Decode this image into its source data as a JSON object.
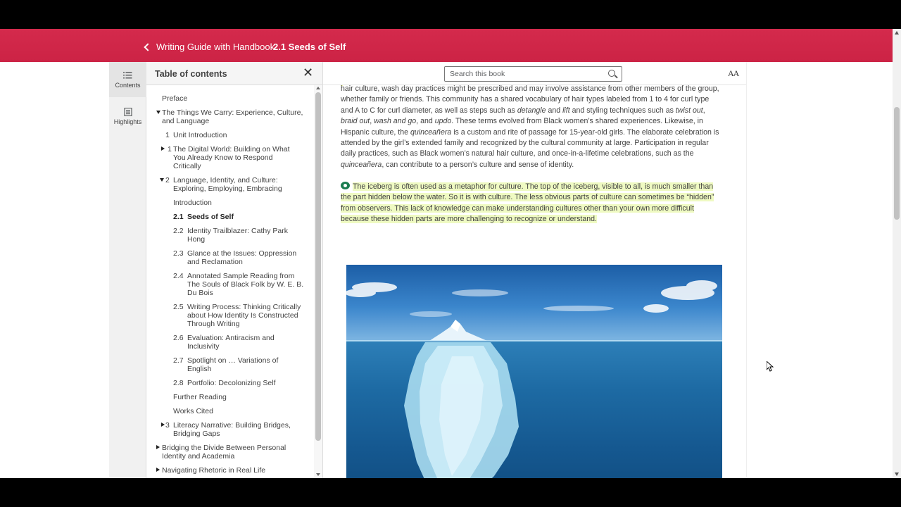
{
  "header": {
    "book_title": "Writing Guide with Handbook",
    "section_title": "2.1 Seeds of Self"
  },
  "rail": {
    "contents_label": "Contents",
    "highlights_label": "Highlights"
  },
  "toc": {
    "title": "Table of contents",
    "items": [
      {
        "num": "",
        "label": "Preface"
      },
      {
        "num": "",
        "label": "The Things We Carry: Experience, Culture,",
        "label2": "and Language"
      },
      {
        "num": "1",
        "label": "Unit Introduction"
      },
      {
        "num": "1",
        "label": "The Digital World: Building on What",
        "label2": "You Already Know to Respond",
        "label3": "Critically"
      },
      {
        "num": "2",
        "label": "Language, Identity, and Culture:",
        "label2": "Exploring, Employing, Embracing"
      },
      {
        "num": "",
        "label": "Introduction"
      },
      {
        "num": "2.1",
        "label": "Seeds of Self"
      },
      {
        "num": "2.2",
        "label": "Identity Trailblazer: Cathy Park",
        "label2": "Hong"
      },
      {
        "num": "2.3",
        "label": "Glance at the Issues: Oppression",
        "label2": "and Reclamation"
      },
      {
        "num": "2.4",
        "label": "Annotated Sample Reading from",
        "label2": "The Souls of Black Folk by W. E. B.",
        "label3": "Du Bois"
      },
      {
        "num": "2.5",
        "label": "Writing Process: Thinking Critically",
        "label2": "about How Identity Is Constructed",
        "label3": "Through Writing"
      },
      {
        "num": "2.6",
        "label": "Evaluation: Antiracism and",
        "label2": "Inclusivity"
      },
      {
        "num": "2.7",
        "label": "Spotlight on … Variations of",
        "label2": "English"
      },
      {
        "num": "2.8",
        "label": "Portfolio: Decolonizing Self"
      },
      {
        "num": "",
        "label": "Further Reading"
      },
      {
        "num": "",
        "label": "Works Cited"
      },
      {
        "num": "3",
        "label": "Literacy Narrative: Building Bridges,",
        "label2": "Bridging Gaps"
      },
      {
        "num": "",
        "label": "Bridging the Divide Between Personal",
        "label2": "Identity and Academia"
      },
      {
        "num": "",
        "label": "Navigating Rhetoric in Real Life"
      }
    ]
  },
  "search": {
    "placeholder": "Search this book"
  },
  "font_toggle": "AA",
  "content": {
    "para1": {
      "l1": "hair culture, wash day practices might be prescribed and may involve assistance from other members of the group,",
      "l2": "whether family or friends. This community has a shared vocabulary of hair types labeled from 1 to 4 for curl type",
      "l3a": "and A to C for curl diameter, as well as steps such as ",
      "l3b": "detangle",
      "l3c": " and ",
      "l3d": "lift",
      "l3e": " and styling techniques such as ",
      "l3f": "twist out",
      "l3g": ",",
      "l4a": "braid out",
      "l4b": ", ",
      "l4c": "wash and go",
      "l4d": ", and ",
      "l4e": "updo",
      "l4f": ". These terms evolved from Black women’s shared experiences. Likewise, in",
      "l5a": "Hispanic culture, the ",
      "l5b": "quinceañera",
      "l5c": " is a custom and rite of passage for 15-year-old girls. The elaborate celebration is",
      "l6": "attended by the girl’s extended family and recognized by the cultural community at large. Participation in regular",
      "l7": "daily practices, such as Black women’s natural hair culture, and once-in-a-lifetime celebrations, such as the",
      "l8a": "quinceañera",
      "l8b": ", can contribute to a person’s culture and sense of identity."
    },
    "para2": {
      "l1": "The iceberg is often used as a metaphor for culture. The top of the iceberg, visible to all, is much smaller than",
      "l2": "the part hidden below the water. So it is with culture. The less obvious parts of culture can sometimes be “hidden”",
      "l3": "from observers. This lack of knowledge can make understanding cultures other than your own more difficult",
      "l4": "because these hidden parts are more challenging to recognize or understand."
    }
  },
  "colors": {
    "brand": "#cc2345",
    "highlight": "#effac2",
    "highlight_icon": "#1a7c4f"
  }
}
